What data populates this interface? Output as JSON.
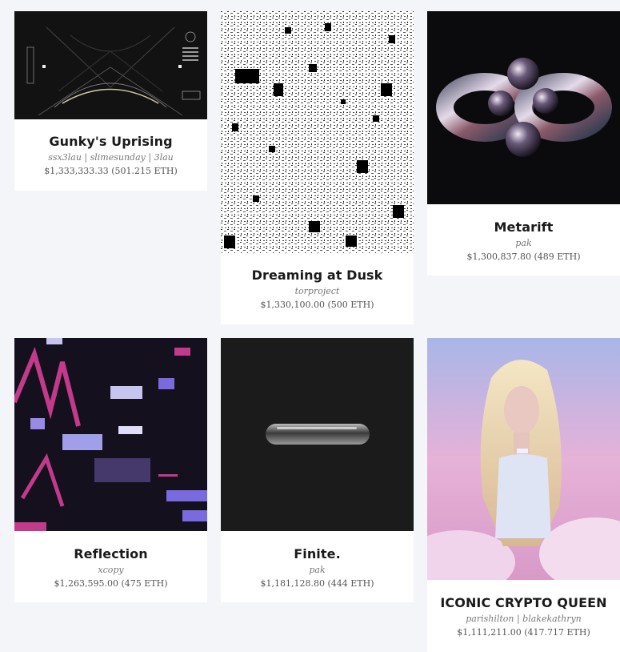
{
  "cards": [
    {
      "title": "Gunky's Uprising",
      "artist": "ssx3lau | slimesunday | 3lau",
      "price": "$1,333,333.33 (501.215 ETH)"
    },
    {
      "title": "Dreaming at Dusk",
      "artist": "torproject",
      "price": "$1,330,100.00 (500 ETH)"
    },
    {
      "title": "Metarift",
      "artist": "pak",
      "price": "$1,300,837.80 (489 ETH)"
    },
    {
      "title": "Reflection",
      "artist": "xcopy",
      "price": "$1,263,595.00 (475 ETH)"
    },
    {
      "title": "Finite.",
      "artist": "pak",
      "price": "$1,181,128.80 (444 ETH)"
    },
    {
      "title": "ICONIC CRYPTO QUEEN",
      "artist": "parishilton | blakekathryn",
      "price": "$1,111,211.00 (417.717 ETH)"
    }
  ],
  "colors": {
    "page_bg": "#f4f5f8",
    "card_bg": "#ffffff",
    "title": "#1a1a1a",
    "artist": "#777777",
    "price": "#555555"
  }
}
